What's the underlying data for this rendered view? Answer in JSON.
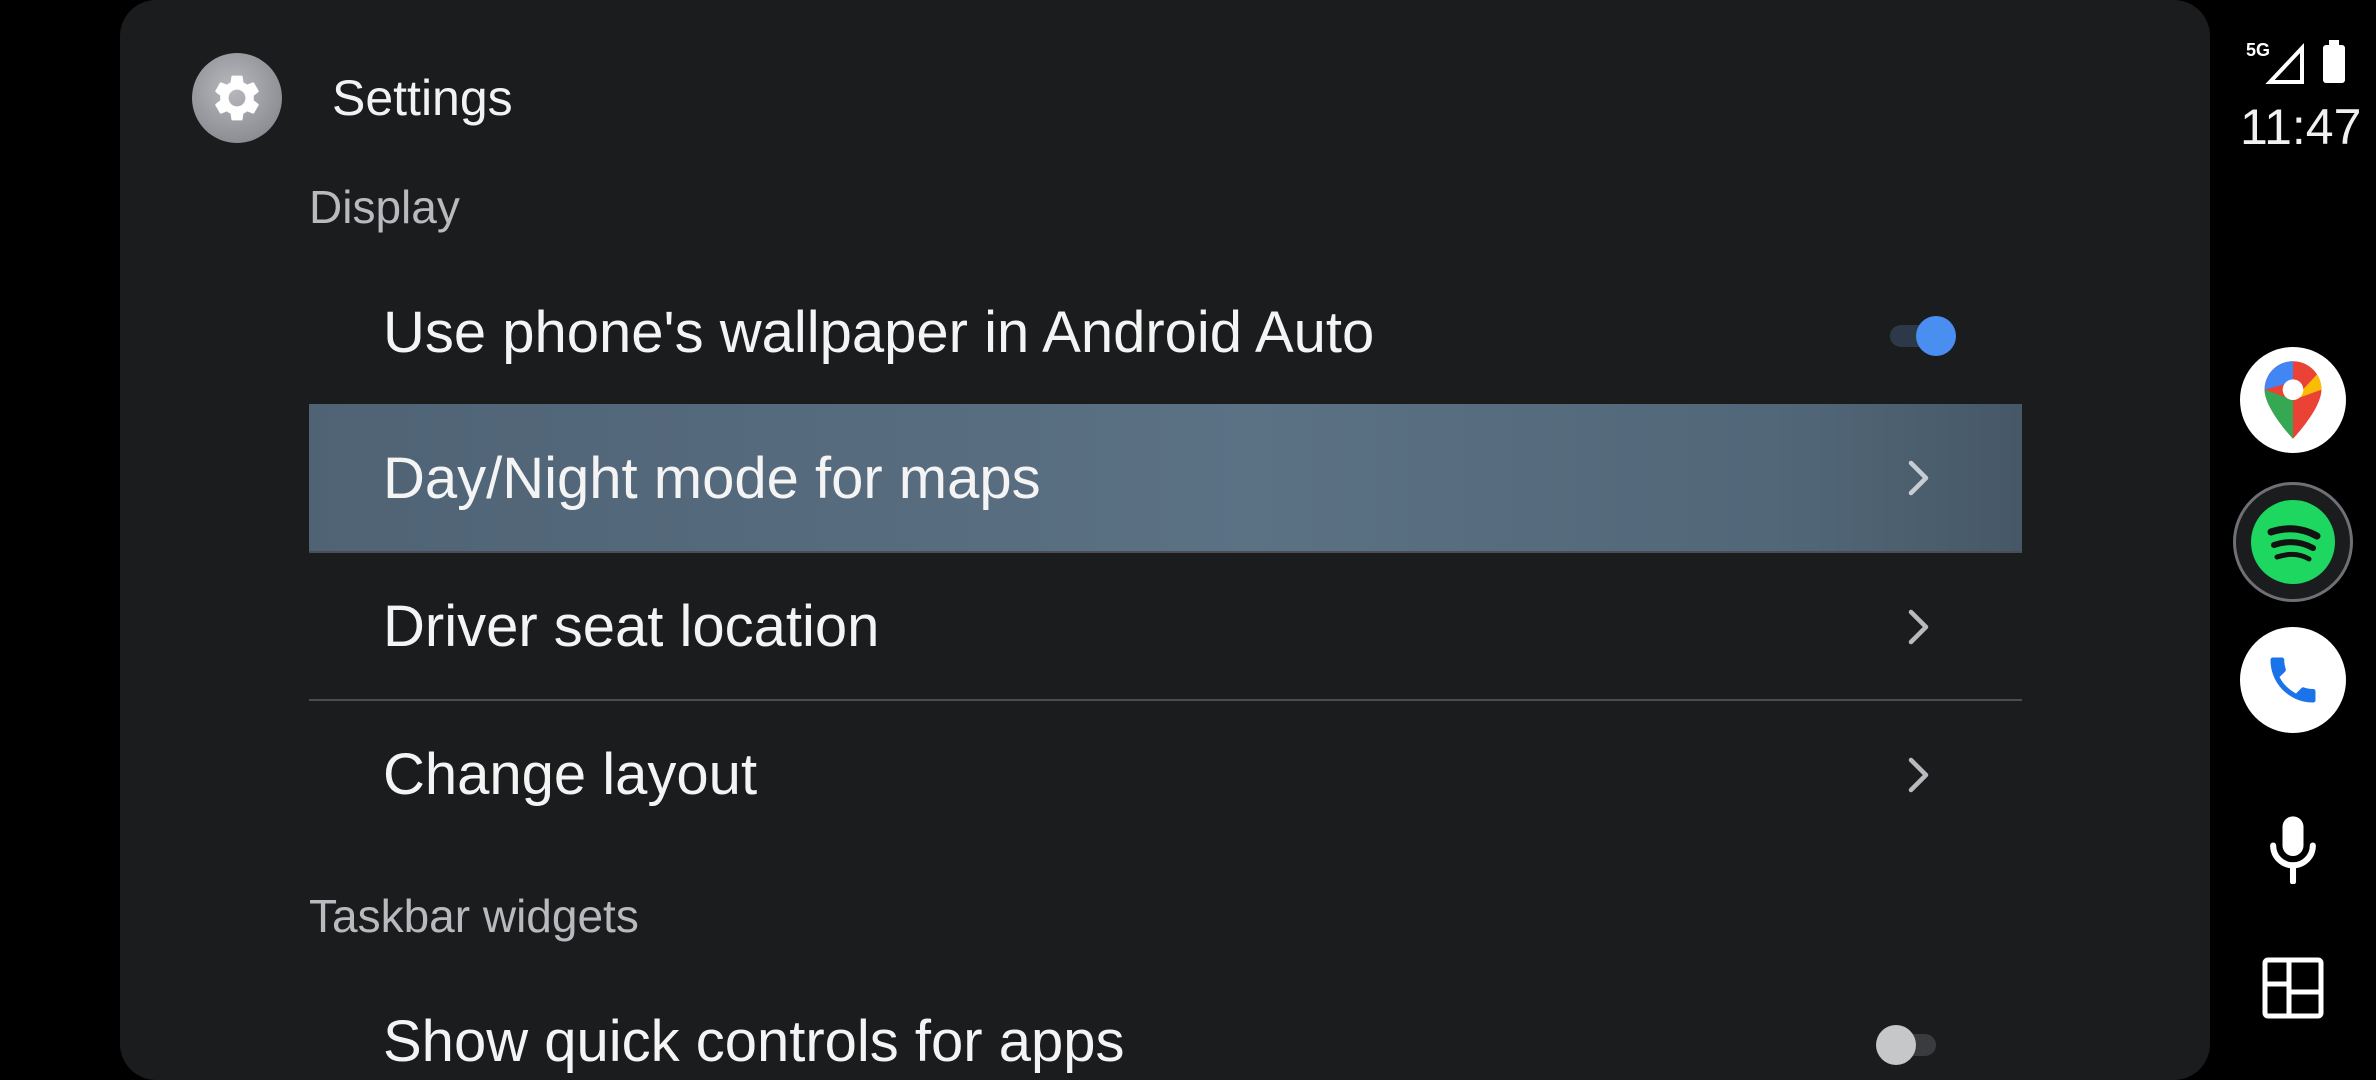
{
  "header": {
    "title": "Settings",
    "icon": "gear-icon"
  },
  "sections": {
    "display": "Display",
    "taskbar": "Taskbar widgets"
  },
  "rows": {
    "wallpaper": {
      "label": "Use phone's wallpaper in Android Auto",
      "toggle": "on"
    },
    "daynight": {
      "label": "Day/Night mode for maps"
    },
    "driver_seat": {
      "label": "Driver seat location"
    },
    "layout": {
      "label": "Change layout"
    },
    "quick_controls": {
      "label": "Show quick controls for apps",
      "toggle": "off"
    }
  },
  "status_bar": {
    "network": "5G",
    "time": "11:47"
  },
  "rail": {
    "apps": [
      "google-maps-icon",
      "spotify-icon",
      "phone-icon"
    ],
    "controls": [
      "microphone-icon",
      "launcher-grid-icon"
    ]
  },
  "colors": {
    "accent": "#4a8ff0",
    "highlight": "#5b7184",
    "panel": "#1b1c1e"
  }
}
